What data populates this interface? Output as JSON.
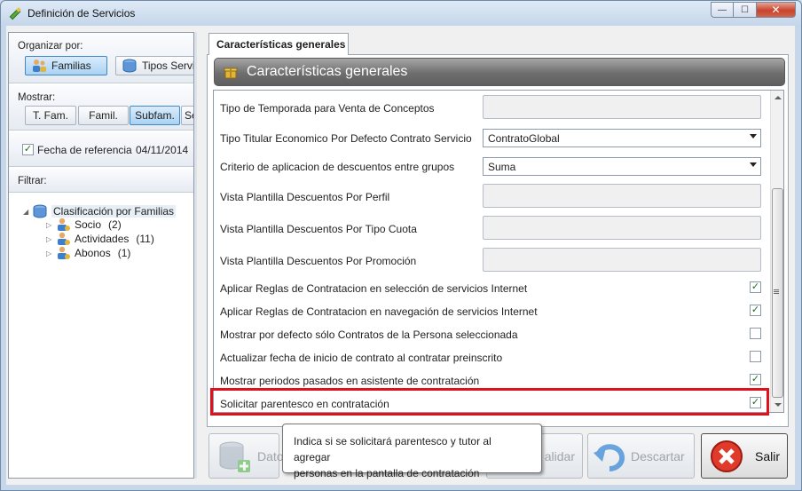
{
  "window": {
    "title": "Definición de Servicios",
    "controls": {
      "minimize": "—",
      "maximize": "☐",
      "close": "✕"
    }
  },
  "left_panel": {
    "organizar": {
      "label": "Organizar por:",
      "buttons": [
        {
          "label": "Familias",
          "selected": true
        },
        {
          "label": "Tipos Servi",
          "selected": false
        }
      ]
    },
    "mostrar": {
      "label": "Mostrar:",
      "buttons": [
        {
          "label": "T. Fam.",
          "selected": false
        },
        {
          "label": "Famil.",
          "selected": false
        },
        {
          "label": "Subfam.",
          "selected": true
        },
        {
          "label": "Se",
          "selected": false
        }
      ]
    },
    "fecha": {
      "label": "Fecha de referencia",
      "value": "04/11/2014",
      "checked": true
    },
    "filtrar": {
      "label": "Filtrar:"
    },
    "tree": {
      "root": {
        "label": "Clasificación por Familias",
        "expander": "◢"
      },
      "children": [
        {
          "label": "Socio",
          "count": "(2)",
          "expander": "▷"
        },
        {
          "label": "Actividades",
          "count": "(11)",
          "expander": "▷"
        },
        {
          "label": "Abonos",
          "count": "(1)",
          "expander": "▷"
        }
      ]
    }
  },
  "tabs": [
    {
      "label": "Características generales",
      "active": true
    }
  ],
  "header": {
    "title": "Características generales"
  },
  "properties": [
    {
      "label": "Tipo de Temporada para Venta de Conceptos",
      "kind": "text",
      "value": ""
    },
    {
      "label": "Tipo Titular Economico Por Defecto Contrato Servicio",
      "kind": "combo",
      "value": "ContratoGlobal"
    },
    {
      "label": "Criterio de aplicacion de descuentos entre grupos",
      "kind": "combo",
      "value": "Suma"
    },
    {
      "label": "Vista Plantilla Descuentos Por Perfil",
      "kind": "text",
      "value": ""
    },
    {
      "label": "Vista Plantilla Descuentos Por Tipo Cuota",
      "kind": "text",
      "value": ""
    },
    {
      "label": "Vista Plantilla Descuentos Por Promoción",
      "kind": "text",
      "value": ""
    },
    {
      "label": "Aplicar Reglas de Contratacion en selección de servicios Internet",
      "kind": "check",
      "checked": true
    },
    {
      "label": "Aplicar Reglas de Contratacion en navegación de servicios Internet",
      "kind": "check",
      "checked": true
    },
    {
      "label": "Mostrar por defecto sólo Contratos de la Persona seleccionada",
      "kind": "check",
      "checked": false
    },
    {
      "label": "Actualizar fecha de inicio de contrato al contratar preinscrito",
      "kind": "check",
      "checked": false
    },
    {
      "label": "Mostrar periodos pasados en asistente de contratación",
      "kind": "check",
      "checked": true
    },
    {
      "label": "Solicitar parentesco en contratación",
      "kind": "check",
      "checked": true
    }
  ],
  "tooltip": {
    "line1": "Indica si se solicitará parentesco y tutor al agregar",
    "line2": "personas en la pantalla de contratación"
  },
  "buttons": {
    "datos": "Dato",
    "validar": "alidar",
    "descartar": "Descartar",
    "salir": "Salir"
  },
  "glyphs": {
    "check": "✓"
  },
  "colors": {
    "highlight": "#e0101c",
    "check": "#1d6b20",
    "header": "#6e6e6e"
  }
}
